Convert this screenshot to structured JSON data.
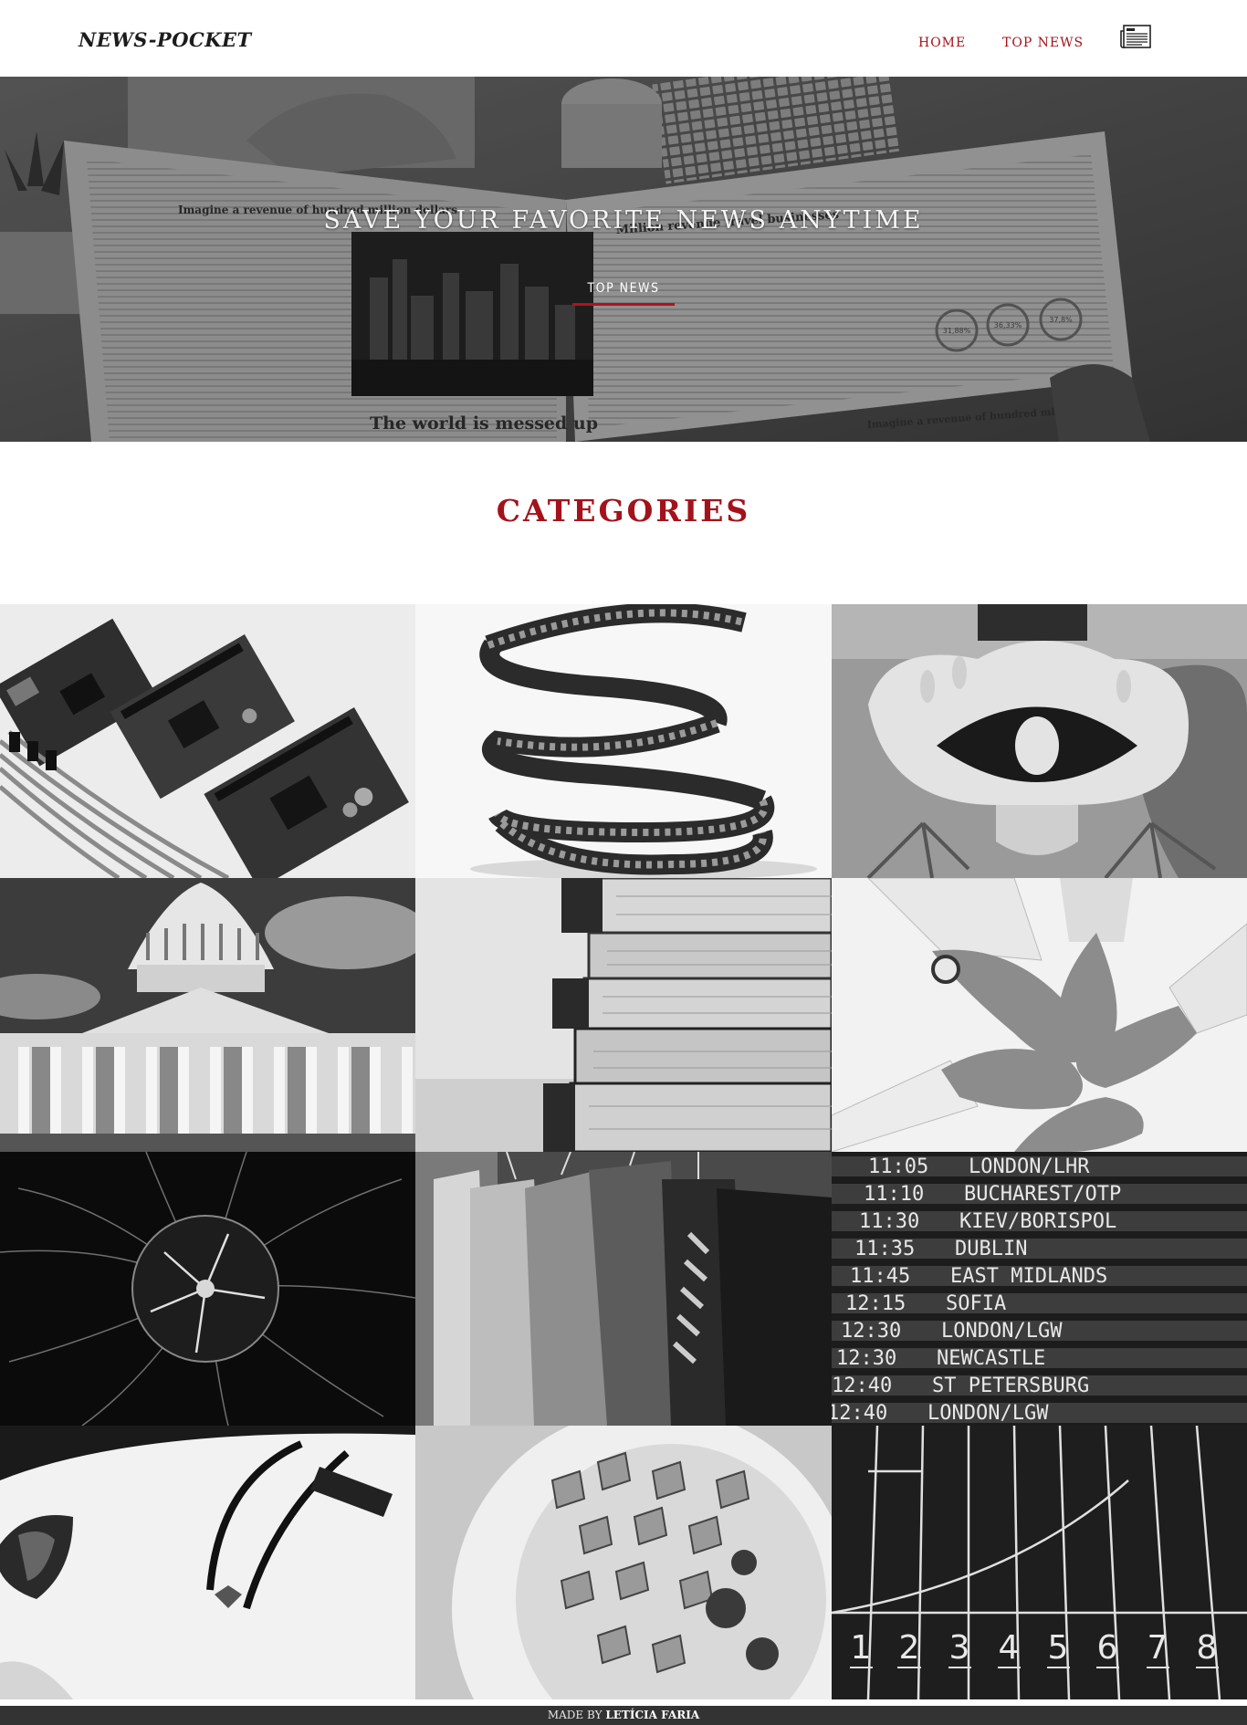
{
  "header": {
    "brand": "NEWS-POCKET",
    "nav": {
      "home": "HOME",
      "top_news": "TOP NEWS"
    },
    "saved_icon": "newspaper-icon"
  },
  "hero": {
    "title": "SAVE YOUR FAVORITE NEWS ANYTIME",
    "link": "TOP NEWS",
    "newspaper_text": {
      "headline_left": "Imagine a revenue of hundred million dollars",
      "headline_center": "Million revenue travel businesses",
      "headline_bottom": "The world is messed up",
      "headline_bottom_right": "Imagine a revenue of hundred million dollars",
      "stat_1": "31,88%",
      "stat_2": "36,33%",
      "stat_3": "37,8%"
    }
  },
  "categories": {
    "title": "CATEGORIES",
    "tiles": [
      {
        "image": "electronics-boards"
      },
      {
        "image": "film-reel"
      },
      {
        "image": "eye-artwork"
      },
      {
        "image": "capitol-building"
      },
      {
        "image": "stacked-books"
      },
      {
        "image": "team-hands"
      },
      {
        "image": "plasma-ball"
      },
      {
        "image": "clothes-rack"
      },
      {
        "image": "departures-board"
      },
      {
        "image": "sports-car"
      },
      {
        "image": "pasta-plate"
      },
      {
        "image": "running-track"
      }
    ],
    "departures": [
      {
        "time": "11:05",
        "dest": "LONDON/LHR"
      },
      {
        "time": "11:10",
        "dest": "BUCHAREST/OTP"
      },
      {
        "time": "11:30",
        "dest": "KIEV/BORISPOL"
      },
      {
        "time": "11:35",
        "dest": "DUBLIN"
      },
      {
        "time": "11:45",
        "dest": "EAST MIDLANDS"
      },
      {
        "time": "12:15",
        "dest": "SOFIA"
      },
      {
        "time": "12:30",
        "dest": "LONDON/LGW"
      },
      {
        "time": "12:30",
        "dest": "NEWCASTLE"
      },
      {
        "time": "12:40",
        "dest": "ST PETERSBURG"
      },
      {
        "time": "12:40",
        "dest": "LONDON/LGW"
      }
    ],
    "lane_numbers": [
      "1",
      "2",
      "3",
      "4",
      "5",
      "6",
      "7",
      "8"
    ]
  },
  "footer": {
    "prefix": "MADE BY",
    "author": "LETÍCIA FARIA"
  }
}
